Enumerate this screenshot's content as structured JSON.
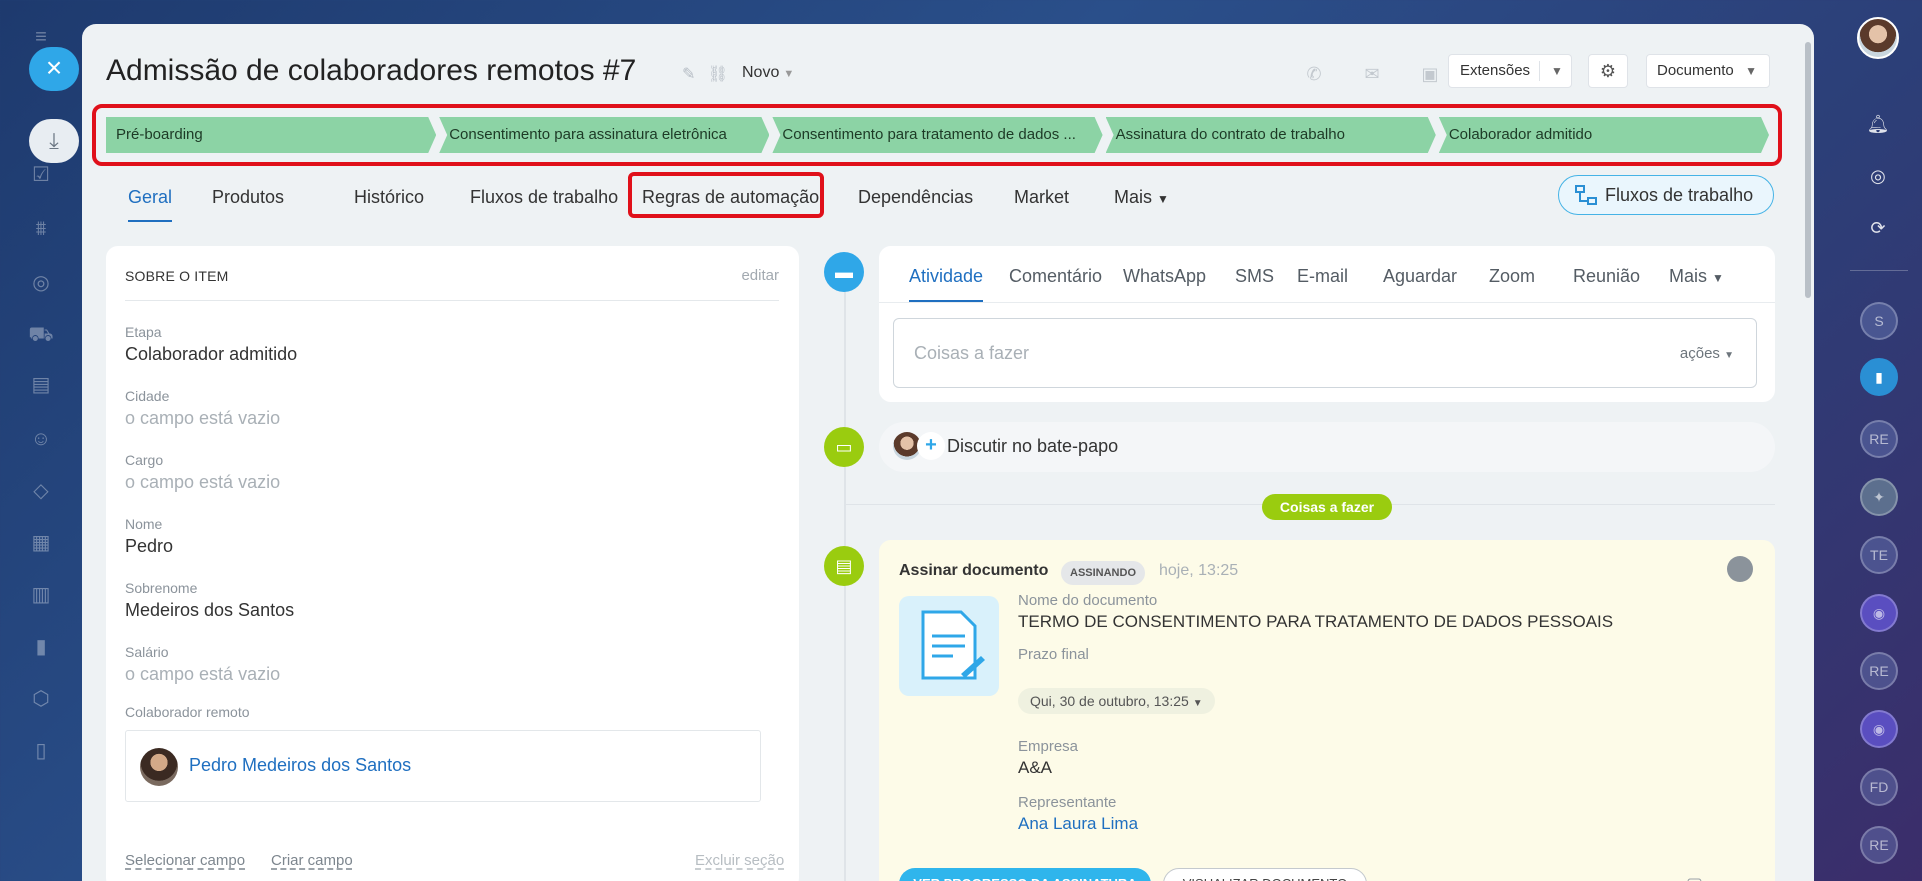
{
  "window": {
    "title": "Admissão de colaboradores remotos #7",
    "status": "Novo"
  },
  "header": {
    "extensions_label": "Extensões",
    "document_label": "Documento"
  },
  "stages": [
    {
      "label": "Pré-boarding"
    },
    {
      "label": "Consentimento para assinatura eletrônica"
    },
    {
      "label": "Consentimento para tratamento de dados ..."
    },
    {
      "label": "Assinatura do contrato de trabalho"
    },
    {
      "label": "Colaborador admitido"
    }
  ],
  "tabs": [
    {
      "label": "Geral"
    },
    {
      "label": "Produtos"
    },
    {
      "label": "Histórico"
    },
    {
      "label": "Fluxos de trabalho"
    },
    {
      "label": "Regras de automação"
    },
    {
      "label": "Dependências"
    },
    {
      "label": "Market"
    },
    {
      "label": "Mais"
    }
  ],
  "flow_button": "Fluxos de trabalho",
  "info_card": {
    "title": "SOBRE O ITEM",
    "edit": "editar",
    "fields": [
      {
        "label": "Etapa",
        "value": "Colaborador admitido"
      },
      {
        "label": "Cidade",
        "value": "o campo está vazio"
      },
      {
        "label": "Cargo",
        "value": "o campo está vazio"
      },
      {
        "label": "Nome",
        "value": "Pedro"
      },
      {
        "label": "Sobrenome",
        "value": "Medeiros dos Santos"
      },
      {
        "label": "Salário",
        "value": "o campo está vazio"
      }
    ],
    "remote_label": "Colaborador remoto",
    "remote_person": "Pedro Medeiros dos Santos",
    "select_field": "Selecionar campo",
    "create_field": "Criar campo",
    "delete_section": "Excluir seção"
  },
  "activity": {
    "tabs": [
      "Atividade",
      "Comentário",
      "WhatsApp",
      "SMS",
      "E-mail",
      "Aguardar",
      "Zoom",
      "Reunião",
      "Mais"
    ],
    "placeholder": "Coisas a fazer",
    "actions": "ações"
  },
  "chat": {
    "label": "Discutir no bate-papo"
  },
  "todo_pill": "Coisas a fazer",
  "document": {
    "title": "Assinar documento",
    "badge": "ASSINANDO",
    "time": "hoje, 13:25",
    "name_label": "Nome do documento",
    "name_value": "TERMO DE CONSENTIMENTO PARA TRATAMENTO DE DADOS PESSOAIS",
    "deadline_label": "Prazo final",
    "deadline_value": "Qui, 30 de outubro, 13:25",
    "company_label": "Empresa",
    "company_value": "A&A",
    "rep_label": "Representante",
    "rep_value": "Ana Laura Lima",
    "btn_progress": "VER PROGRESSO DA ASSINATURA",
    "btn_view": "VISUALIZAR DOCUMENTO"
  },
  "right_rail": {
    "bubbles": [
      "S",
      "RE",
      "TE",
      "RE",
      "FD",
      "RE"
    ]
  },
  "colors": {
    "accent": "#2fa7e8",
    "stage_green": "#8cd3a5",
    "highlight_red": "#e0101a",
    "todo_green": "#9acc0f",
    "link_blue": "#1f6fc0"
  }
}
